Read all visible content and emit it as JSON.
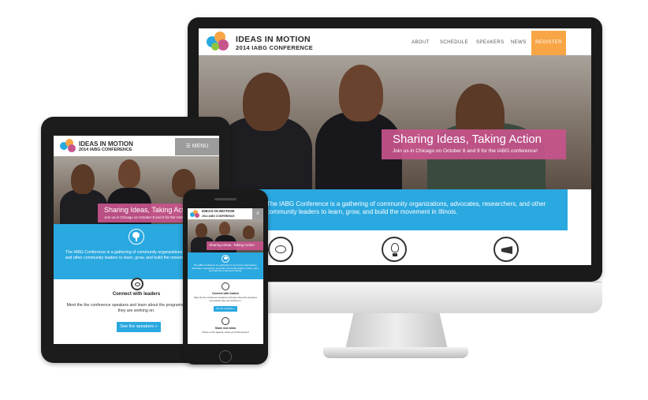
{
  "site": {
    "logo_title": "IDEAS IN MOTION",
    "logo_subtitle": "2014 IABG CONFERENCE"
  },
  "desktop": {
    "nav": [
      "ABOUT",
      "SCHEDULE",
      "SPEAKERS",
      "NEWS"
    ],
    "register_label": "REGISTER",
    "banner_title": "Sharing Ideas, Taking Action",
    "banner_subtitle": "Join us in Chicago on October 8 and 9 for the IABG conference!",
    "intro": "The IABG Conference is a gathering of community organizations, advocates, researchers, and other community leaders to learn, grow, and build the movement in Illinois.",
    "icons": [
      "speech-bubble-icon",
      "lightbulb-icon",
      "megaphone-icon"
    ]
  },
  "tablet": {
    "menu_label": "☰ MENU",
    "banner_title": "Sharing Ideas, Taking Action",
    "banner_subtitle": "Join us in Chicago on October 8 and 9 for the IABG",
    "intro": "The IABG Conference is a gathering of community organizations, researchers, and other community leaders to learn, grow, and build the movement in Illinois.",
    "connect_heading": "Connect with leaders",
    "meet_text": "Meet the the conference speakers and learn about the programs and policies they are working on.",
    "button_label": "See the speakers  »"
  },
  "phone": {
    "menu_label": "≡",
    "banner_title": "Sharing Ideas, Taking Action",
    "intro": "The IABG Conference is a gathering of community organizations, advocates, researchers, and other community leaders to learn, grow, and build the movement in Illinois.",
    "connect_heading": "Connect with leaders",
    "meet_text": "Meet the the conference speakers and learn about the programs and policies they are working on.",
    "button_label": "See the speakers  »",
    "share_heading": "Share new ideas",
    "check_text": "Check out the agenda, where you'll find dynamic"
  },
  "colors": {
    "accent_blue": "#2aa8e0",
    "banner_pink": "#c8548c",
    "register_orange": "#f8a545"
  }
}
